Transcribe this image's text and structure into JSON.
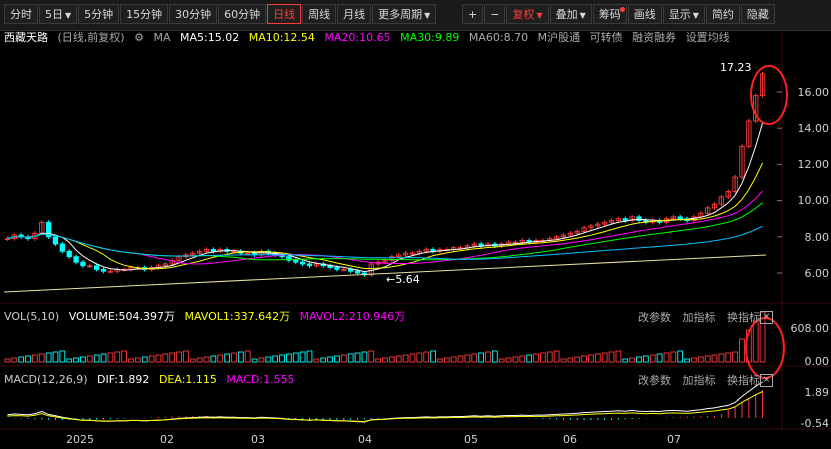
{
  "toolbar": {
    "periods": [
      "分时",
      "5日",
      "5分钟",
      "15分钟",
      "30分钟",
      "60分钟",
      "日线",
      "周线",
      "月线",
      "更多周期"
    ],
    "active_period": "日线",
    "right_buttons": [
      "+",
      "−",
      "复权",
      "叠加",
      "筹码",
      "画线",
      "显示",
      "简约",
      "隐藏"
    ]
  },
  "stock": {
    "name": "西藏天路",
    "mode": "(日线,前复权)"
  },
  "ma_legend": {
    "ma": "MA",
    "ma5": "MA5:15.02",
    "ma10": "MA10:12.54",
    "ma20": "MA20:10.65",
    "ma30": "MA30:9.89",
    "ma60": "MA60:8.70",
    "extra": [
      "M沪股通",
      "可转债",
      "融资融券",
      "设置均线"
    ]
  },
  "price_axis": [
    "16.00",
    "14.00",
    "12.00",
    "10.00",
    "8.00",
    "6.00"
  ],
  "annotations": {
    "high": "17.23",
    "low": "5.64"
  },
  "vol_legend": {
    "title": "VOL(5,10)",
    "volume": "VOLUME:504.397万",
    "mavol1": "MAVOL1:337.642万",
    "mavol2": "MAVOL2:210.946万",
    "btns": [
      "改参数",
      "加指标",
      "换指标"
    ]
  },
  "vol_axis": [
    "608.00",
    "0.00"
  ],
  "macd_legend": {
    "title": "MACD(12,26,9)",
    "dif": "DIF:1.892",
    "dea": "DEA:1.115",
    "macd": "MACD:1.555",
    "btns": [
      "改参数",
      "加指标",
      "换指标"
    ]
  },
  "macd_axis": [
    "1.89",
    "-0.54"
  ],
  "x_axis": [
    "2025",
    "02",
    "03",
    "04",
    "05",
    "06",
    "07"
  ],
  "colors": {
    "up": "#ff3b3b",
    "down": "#00ffff",
    "ma5": "#ffffff",
    "ma10": "#ffff00",
    "ma20": "#ff00ff",
    "ma30": "#00ff00",
    "ma60": "#00bfff"
  },
  "chart_data": {
    "type": "candlestick",
    "closes": [
      7.9,
      8.1,
      8.0,
      7.9,
      8.2,
      8.8,
      8.0,
      7.6,
      7.2,
      6.9,
      6.6,
      6.4,
      6.4,
      6.2,
      6.1,
      6.1,
      6.2,
      6.2,
      6.3,
      6.3,
      6.2,
      6.3,
      6.4,
      6.5,
      6.7,
      6.9,
      7.0,
      7.1,
      7.2,
      7.3,
      7.2,
      7.3,
      7.2,
      7.2,
      7.1,
      7.1,
      7.0,
      7.2,
      7.1,
      7.0,
      6.9,
      6.7,
      6.6,
      6.5,
      6.4,
      6.5,
      6.4,
      6.3,
      6.2,
      6.2,
      6.1,
      6.0,
      5.9,
      6.5,
      6.6,
      6.7,
      6.9,
      7.0,
      7.1,
      7.1,
      7.2,
      7.3,
      7.2,
      7.3,
      7.3,
      7.4,
      7.4,
      7.5,
      7.6,
      7.5,
      7.6,
      7.5,
      7.6,
      7.7,
      7.7,
      7.8,
      7.7,
      7.8,
      7.8,
      7.9,
      8.0,
      8.1,
      8.2,
      8.3,
      8.5,
      8.6,
      8.7,
      8.8,
      8.9,
      9.0,
      8.9,
      9.1,
      8.9,
      8.8,
      8.9,
      8.8,
      9.0,
      9.1,
      9.0,
      8.9,
      9.1,
      9.3,
      9.6,
      9.8,
      10.2,
      10.5,
      11.3,
      13.0,
      14.4,
      15.8,
      17.0
    ]
  }
}
